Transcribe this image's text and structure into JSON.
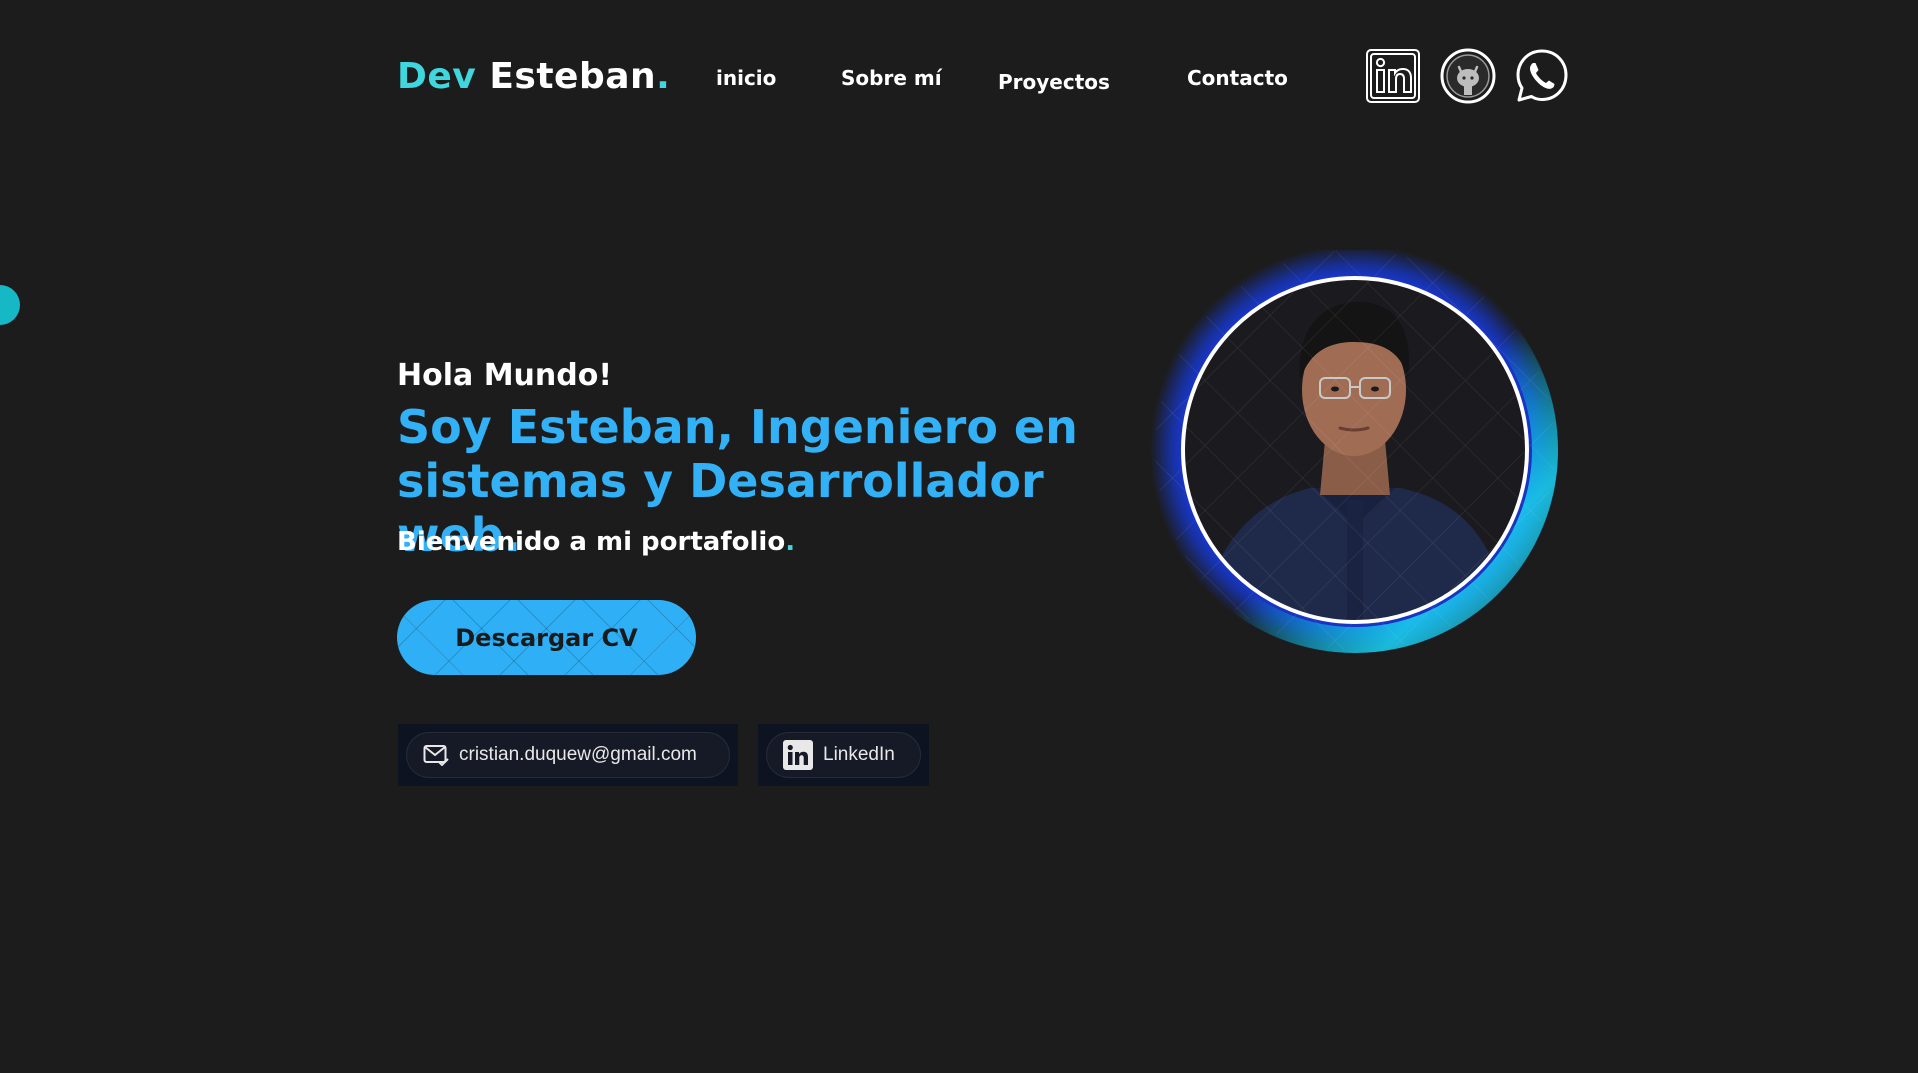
{
  "header": {
    "logo": {
      "accent": "Dev",
      "main": "Esteban",
      "dot": "."
    },
    "nav": [
      {
        "label": "inicio"
      },
      {
        "label": "Sobre mí"
      },
      {
        "label": "Proyectos"
      },
      {
        "label": "Contacto"
      }
    ],
    "social_icons": [
      "linkedin-icon",
      "github-icon",
      "whatsapp-icon"
    ]
  },
  "hero": {
    "greeting": "Hola Mundo!",
    "headline": "Soy Esteban, Ingeniero en sistemas y Desarrollador web.",
    "welcome": "Bienvenido a mi portafolio",
    "welcome_dot": ".",
    "cv_button": "Descargar CV"
  },
  "contact": {
    "email": "cristian.duquew@gmail.com",
    "linkedin": "LinkedIn"
  },
  "colors": {
    "background": "#1c1c1c",
    "accent_cyan": "#3fd6de",
    "accent_blue": "#33b1f7",
    "text": "#ffffff"
  }
}
